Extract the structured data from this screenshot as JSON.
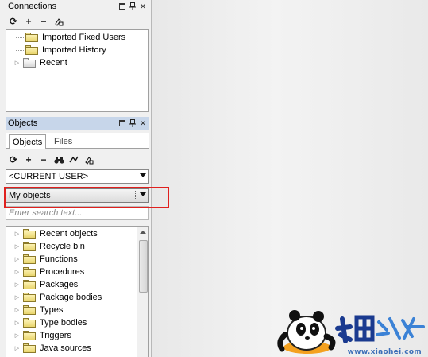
{
  "connections": {
    "title": "Connections",
    "tree": [
      {
        "label": "Imported Fixed Users",
        "icon": "folder-icon"
      },
      {
        "label": "Imported History",
        "icon": "folder-icon"
      },
      {
        "label": "Recent",
        "icon": "folder-grey-icon",
        "expandable": true
      }
    ]
  },
  "objects": {
    "title": "Objects",
    "tabs": [
      {
        "label": "Objects",
        "active": true
      },
      {
        "label": "Files",
        "active": false
      }
    ],
    "user_select": "<CURRENT USER>",
    "filter_select": "My objects",
    "search_placeholder": "Enter search text...",
    "tree": [
      {
        "label": "Recent objects"
      },
      {
        "label": "Recycle bin"
      },
      {
        "label": "Functions"
      },
      {
        "label": "Procedures"
      },
      {
        "label": "Packages"
      },
      {
        "label": "Package bodies"
      },
      {
        "label": "Types"
      },
      {
        "label": "Type bodies"
      },
      {
        "label": "Triggers"
      },
      {
        "label": "Java sources"
      }
    ]
  },
  "watermark": {
    "logo_text": "小黑游戏",
    "url": "www.xiaohei.com"
  },
  "colors": {
    "active_header": "#c7d6ea",
    "highlight_box": "#e0201e",
    "watermark_blue": "#3d6fb8"
  }
}
